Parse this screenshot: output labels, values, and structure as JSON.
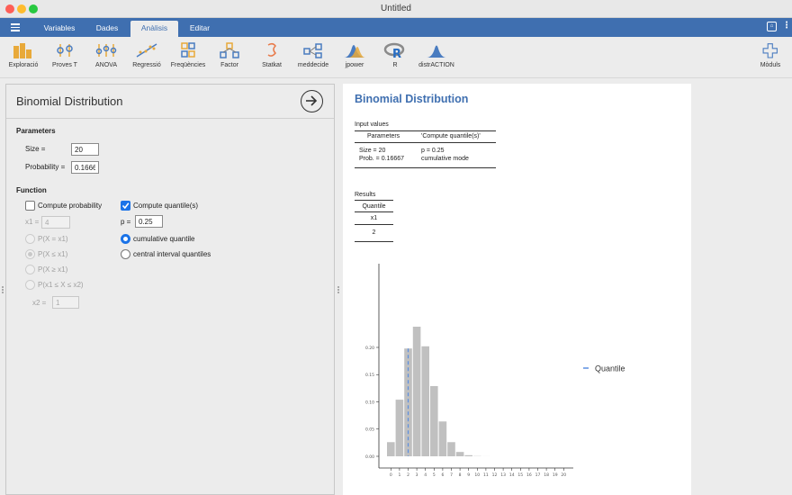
{
  "window": {
    "title": "Untitled"
  },
  "menu": {
    "tabs": [
      "Variables",
      "Dades",
      "Anàlisis",
      "Editar"
    ],
    "active_index": 2
  },
  "ribbon": {
    "items": [
      "Exploració",
      "Proves T",
      "ANOVA",
      "Regressió",
      "Freqüències",
      "Factor",
      "Statkat",
      "meddecide",
      "jpower",
      "R",
      "distrACTION"
    ],
    "modules_label": "Mòduls"
  },
  "options": {
    "title": "Binomial Distribution",
    "parameters": {
      "heading": "Parameters",
      "size_label": "Size =",
      "size_value": "20",
      "prob_label": "Probability =",
      "prob_value": "0.1666"
    },
    "function": {
      "heading": "Function",
      "compute_probability": {
        "label": "Compute probability",
        "checked": false
      },
      "x1_label": "x1 =",
      "x1_value": "4",
      "prob_options": [
        "P(X = x1)",
        "P(X ≤ x1)",
        "P(X ≥ x1)",
        "P(x1 ≤ X ≤ x2)"
      ],
      "x2_label": "x2 =",
      "x2_value": "1",
      "compute_quantiles": {
        "label": "Compute quantile(s)",
        "checked": true
      },
      "p_label": "p =",
      "p_value": "0.25",
      "quantile_options": [
        "cumulative quantile",
        "central interval quantiles"
      ],
      "selected_quantile": 0
    }
  },
  "results": {
    "title": "Binomial Distribution",
    "input_table": {
      "caption": "Input values",
      "headers": [
        "Parameters",
        "'Compute quantile(s)'"
      ],
      "col1": [
        "Size = 20",
        "Prob. = 0.16667"
      ],
      "col2": [
        "p = 0.25",
        "cumulative mode"
      ]
    },
    "results_table": {
      "caption": "Results",
      "header": "Quantile",
      "subheader": "x1",
      "value": "2"
    }
  },
  "colors": {
    "accent": "#3f6fb0",
    "bar": "#c0c0c0",
    "quantile_line": "#5b8fe0",
    "checkbox": "#1a73e8"
  },
  "chart_data": {
    "type": "bar",
    "x": [
      0,
      1,
      2,
      3,
      4,
      5,
      6,
      7,
      8,
      9,
      10,
      11,
      12,
      13,
      14,
      15,
      16,
      17,
      18,
      19,
      20
    ],
    "values": [
      0.026,
      0.104,
      0.198,
      0.238,
      0.202,
      0.129,
      0.064,
      0.026,
      0.008,
      0.002,
      0.0004,
      0.0001,
      0,
      0,
      0,
      0,
      0,
      0,
      0,
      0,
      0
    ],
    "yticks": [
      0.0,
      0.05,
      0.1,
      0.15,
      0.2
    ],
    "ytick_labels": [
      "0.00",
      "0.05",
      "0.10",
      "0.15",
      "0.20"
    ],
    "xtick_labels": [
      "0",
      "1",
      "2",
      "3",
      "4",
      "5",
      "6",
      "7",
      "8",
      "9",
      "10",
      "11",
      "12",
      "13",
      "14",
      "15",
      "16",
      "17",
      "18",
      "19",
      "20"
    ],
    "ylim": [
      0,
      0.25
    ],
    "quantile_x": 2,
    "legend": {
      "label": "Quantile",
      "position": "right"
    },
    "grid": false
  }
}
